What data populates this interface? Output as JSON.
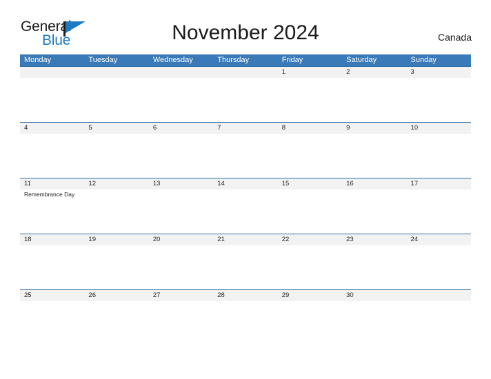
{
  "brand": {
    "name_part1": "General",
    "name_part2": "Blue",
    "flag_icon": "flag-icon",
    "accent_color": "#1f7ac4"
  },
  "header": {
    "title": "November 2024",
    "region": "Canada"
  },
  "calendar": {
    "header_bg_color": "#3a7ab8",
    "date_strip_bg_color": "#f2f2f2",
    "date_strip_border_color": "#2e6da4",
    "weekday_headers": [
      "Monday",
      "Tuesday",
      "Wednesday",
      "Thursday",
      "Friday",
      "Saturday",
      "Sunday"
    ],
    "weeks": [
      {
        "dates": [
          "",
          "",
          "",
          "",
          "1",
          "2",
          "3"
        ],
        "events": [
          "",
          "",
          "",
          "",
          "",
          "",
          ""
        ]
      },
      {
        "dates": [
          "4",
          "5",
          "6",
          "7",
          "8",
          "9",
          "10"
        ],
        "events": [
          "",
          "",
          "",
          "",
          "",
          "",
          ""
        ]
      },
      {
        "dates": [
          "11",
          "12",
          "13",
          "14",
          "15",
          "16",
          "17"
        ],
        "events": [
          "Remembrance Day",
          "",
          "",
          "",
          "",
          "",
          ""
        ]
      },
      {
        "dates": [
          "18",
          "19",
          "20",
          "21",
          "22",
          "23",
          "24"
        ],
        "events": [
          "",
          "",
          "",
          "",
          "",
          "",
          ""
        ]
      },
      {
        "dates": [
          "25",
          "26",
          "27",
          "28",
          "29",
          "30",
          ""
        ],
        "events": [
          "",
          "",
          "",
          "",
          "",
          "",
          ""
        ]
      }
    ]
  }
}
